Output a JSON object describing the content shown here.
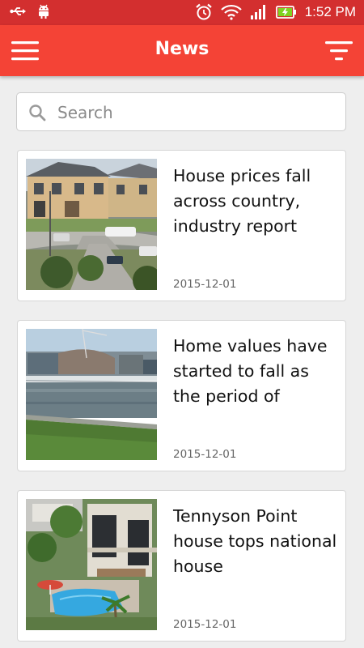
{
  "status_bar": {
    "time": "1:52 PM",
    "icons": [
      "usb-icon",
      "android-icon",
      "alarm-icon",
      "wifi-icon",
      "signal-icon",
      "battery-charging-icon"
    ]
  },
  "app_bar": {
    "title": "News",
    "left_icon": "menu-icon",
    "right_icon": "filter-icon"
  },
  "search": {
    "placeholder": "Search",
    "value": ""
  },
  "articles": [
    {
      "title": "House prices fall across country, industry report",
      "date": "2015-12-01",
      "image": "suburban-houses-photo"
    },
    {
      "title": "Home values have started to fall as the period of",
      "date": "2015-12-01",
      "image": "riverside-bridge-photo"
    },
    {
      "title": "Tennyson Point house tops national house",
      "date": "2015-12-01",
      "image": "house-with-pool-photo"
    }
  ],
  "colors": {
    "status_bar": "#d32f2f",
    "app_bar": "#f44336",
    "background": "#eeeeee"
  }
}
